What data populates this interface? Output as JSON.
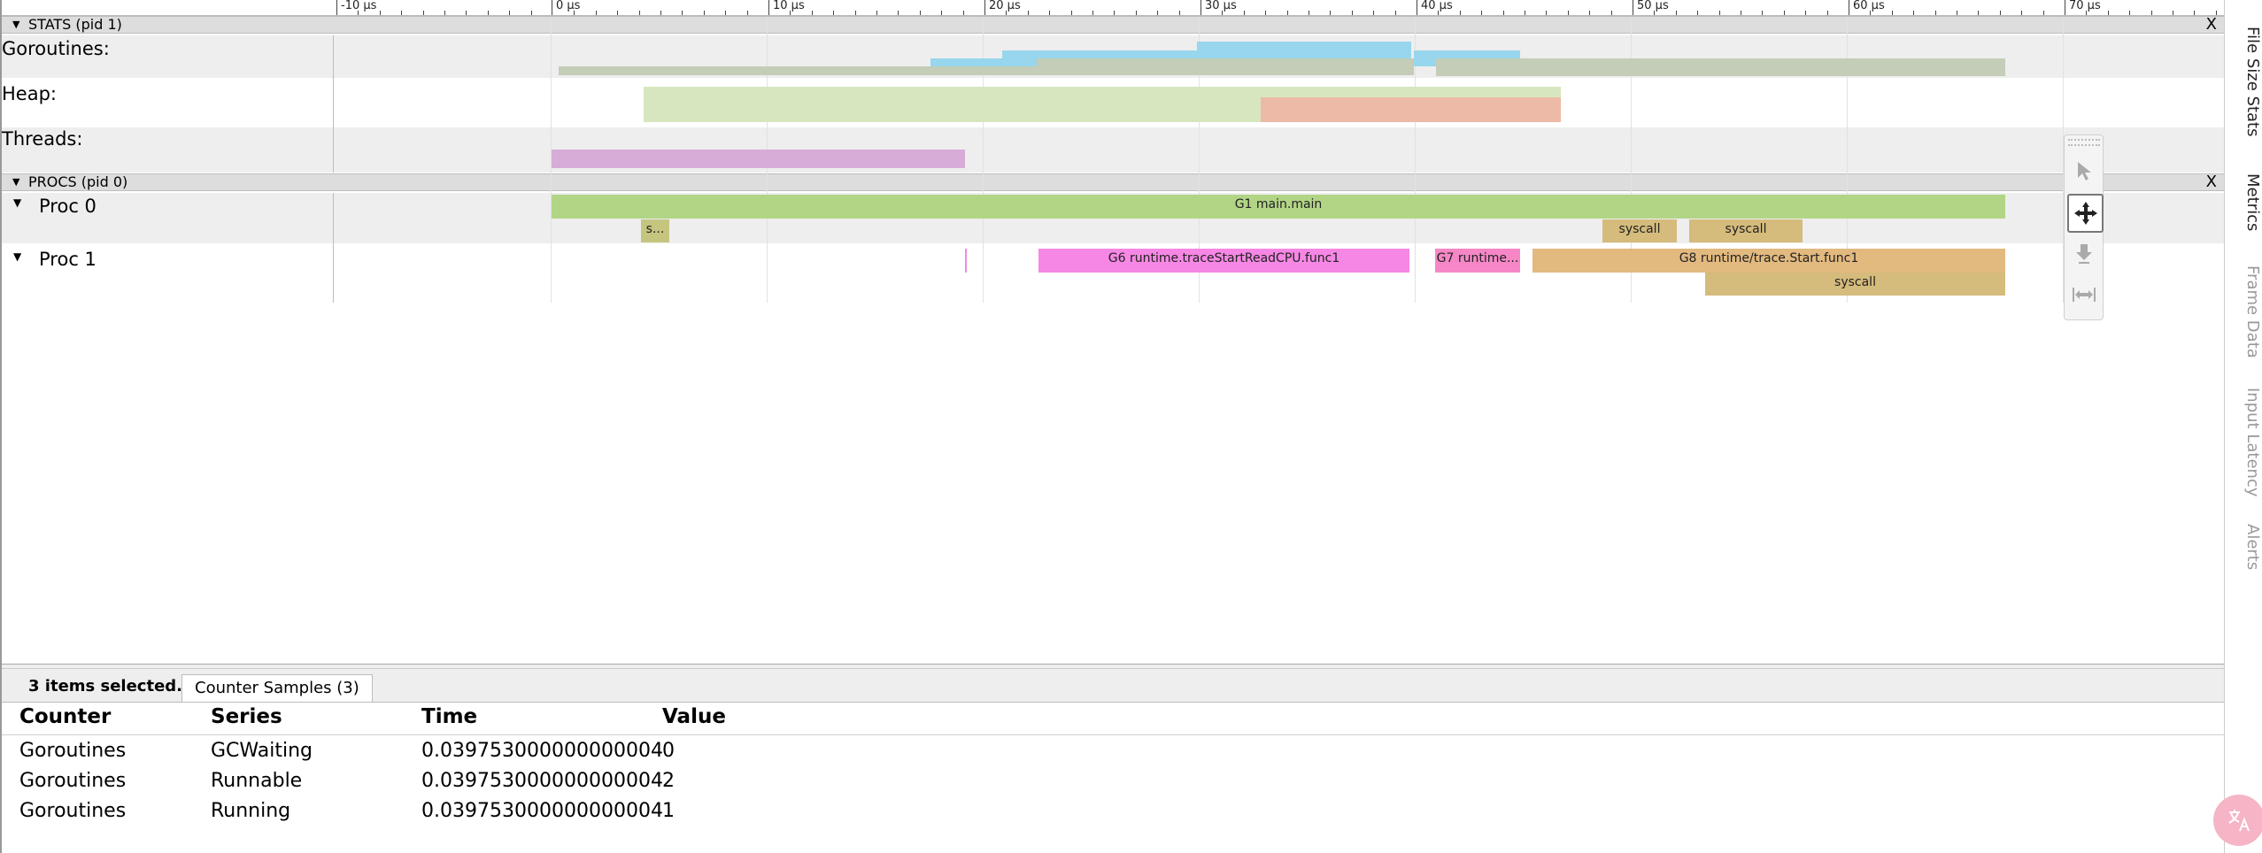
{
  "ruler": {
    "ticks": [
      "-10 μs",
      "0 μs",
      "10 μs",
      "20 μs",
      "30 μs",
      "40 μs",
      "50 μs",
      "60 μs",
      "70 μs"
    ]
  },
  "stats": {
    "header": "STATS (pid 1)",
    "close": "X",
    "tracks": [
      "Goroutines:",
      "Heap:",
      "Threads:"
    ]
  },
  "procs": {
    "header": "PROCS (pid 0)",
    "close": "X",
    "proc0": {
      "label": "Proc 0",
      "slices": [
        "G1 main.main",
        "s...",
        "syscall",
        "syscall"
      ]
    },
    "proc1": {
      "label": "Proc 1",
      "slices": [
        "G6 runtime.traceStartReadCPU.func1",
        "G7 runtime...",
        "G8 runtime/trace.Start.func1",
        "syscall"
      ]
    }
  },
  "side_tabs": [
    "File Size Stats",
    "Metrics",
    "Frame Data",
    "Input Latency",
    "Alerts"
  ],
  "bottom_panel": {
    "selection": "3 items selected.",
    "tab": "Counter Samples (3)",
    "columns": [
      "Counter",
      "Series",
      "Time",
      "Value"
    ],
    "rows": [
      {
        "counter": "Goroutines",
        "series": "GCWaiting",
        "time": "0.039753000000000004",
        "value": "0"
      },
      {
        "counter": "Goroutines",
        "series": "Runnable",
        "time": "0.039753000000000004",
        "value": "2"
      },
      {
        "counter": "Goroutines",
        "series": "Running",
        "time": "0.039753000000000004",
        "value": "1"
      }
    ]
  },
  "colors": {
    "g1": "#b2d585",
    "g6": "#f687e4",
    "g7": "#f687c6",
    "g8": "#e2b97f",
    "syscall": "#d5bb7c",
    "goroutines_a": "#c4cdb7",
    "goroutines_b": "#97d6ec",
    "heap_a": "#d7e6bf",
    "heap_b": "#ecbaa6",
    "threads": "#d7acd7"
  },
  "fab_icon": "translate-icon"
}
